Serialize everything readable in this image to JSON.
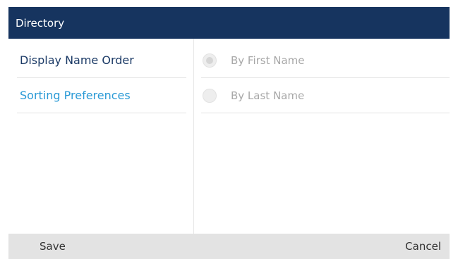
{
  "title": "Directory",
  "menu": {
    "items": [
      {
        "label": "Display Name Order"
      },
      {
        "label": "Sorting Preferences"
      }
    ]
  },
  "options": [
    {
      "label": "By First Name",
      "checked": true
    },
    {
      "label": "By Last Name",
      "checked": false
    }
  ],
  "softkeys": {
    "save_label": "Save",
    "cancel_label": "Cancel"
  },
  "colors": {
    "title_bar": "#16345f",
    "menu_active_text": "#1b3a66",
    "menu_selected_text": "#2a9ad6",
    "softkey_bar": "#e3e3e3"
  }
}
